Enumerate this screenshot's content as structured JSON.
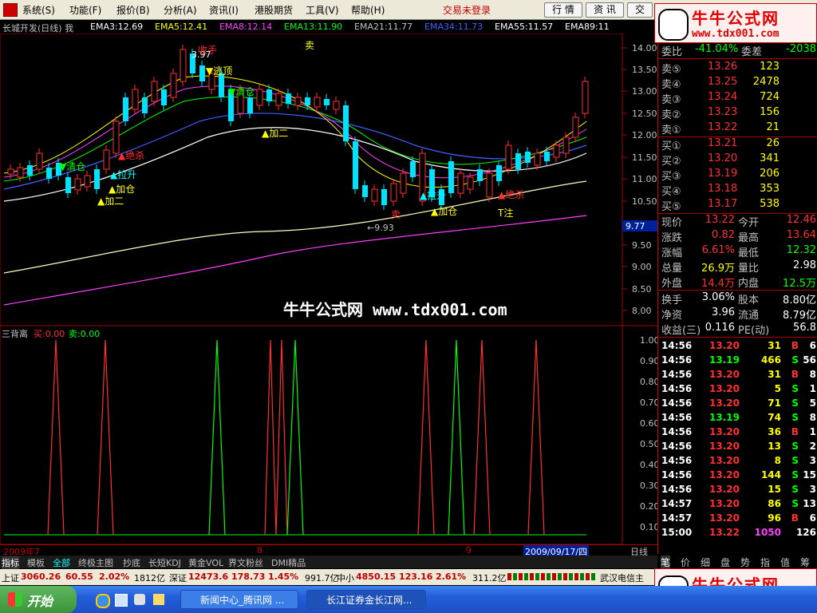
{
  "menu": {
    "items": [
      "系统(S)",
      "功能(F)",
      "报价(B)",
      "分析(A)",
      "资讯(I)",
      "港股期货",
      "工具(V)",
      "帮助(H)"
    ],
    "trade_login": "交易未登录",
    "buttons": [
      "行 情",
      "资 讯",
      "交"
    ]
  },
  "chart": {
    "title": "长城开发(日线) 我",
    "emas": [
      {
        "label": "EMA3:12.69",
        "color": "#ffffff"
      },
      {
        "label": "EMA5:12.41",
        "color": "#ffff00"
      },
      {
        "label": "EMA8:12.14",
        "color": "#ff40ff"
      },
      {
        "label": "EMA13:11.90",
        "color": "#00ff00"
      },
      {
        "label": "EMA21:11.77",
        "color": "#c0c0c0"
      },
      {
        "label": "EMA34:11.73",
        "color": "#4060ff"
      },
      {
        "label": "EMA55:11.57",
        "color": "#ffffff"
      },
      {
        "label": "EMA89:11",
        "color": "#ffffff"
      }
    ],
    "price_axis": [
      "14.00",
      "13.50",
      "13.00",
      "12.50",
      "12.00",
      "11.50",
      "11.00",
      "10.50",
      "10.00",
      "9.50",
      "9.00",
      "8.50",
      "8.00"
    ],
    "current_price_tag": "9.77",
    "annotations": {
      "high_mark": "3.97",
      "low_mark": "←9.93",
      "labels": [
        "收手",
        "卖",
        "▼清仓",
        "▼逃顶",
        "▼清仓",
        "▲加二",
        "▲加仓",
        "▲加二",
        "▲拉升",
        "▲绝杀",
        "▲绝杀",
        "▲拉升",
        "▲加仓",
        "卖",
        "T注",
        "▲加二",
        "收手",
        "▲加仓",
        "▲拉升",
        "▲加二"
      ]
    },
    "watermark": "牛牛公式网 www.tdx001.com",
    "indicator": {
      "name": "三背离",
      "buy_label": "买:0.00",
      "sell_label": "卖:0.00",
      "axis": [
        "1.00",
        "0.90",
        "0.80",
        "0.70",
        "0.60",
        "0.50",
        "0.40",
        "0.30",
        "0.20",
        "0.10"
      ]
    },
    "date_axis": {
      "left": "2009年7",
      "mid1": "8",
      "mid2": "9",
      "cursor": "2009/09/17/四",
      "period": "日线"
    }
  },
  "quote": {
    "ratio": {
      "label1": "委比",
      "val1": "-41.04%",
      "label2": "委差",
      "val2": "-2038"
    },
    "asks": [
      {
        "label": "卖⑤",
        "price": "13.26",
        "vol": "123"
      },
      {
        "label": "卖④",
        "price": "13.25",
        "vol": "2478"
      },
      {
        "label": "卖③",
        "price": "13.24",
        "vol": "724"
      },
      {
        "label": "卖②",
        "price": "13.23",
        "vol": "156"
      },
      {
        "label": "卖①",
        "price": "13.22",
        "vol": "21"
      }
    ],
    "bids": [
      {
        "label": "买①",
        "price": "13.21",
        "vol": "26"
      },
      {
        "label": "买②",
        "price": "13.20",
        "vol": "341"
      },
      {
        "label": "买③",
        "price": "13.19",
        "vol": "206"
      },
      {
        "label": "买④",
        "price": "13.18",
        "vol": "353"
      },
      {
        "label": "买⑤",
        "price": "13.17",
        "vol": "538"
      }
    ],
    "stats": [
      {
        "l1": "现价",
        "v1": "13.22",
        "c1": "red",
        "l2": "今开",
        "v2": "12.46",
        "c2": "red"
      },
      {
        "l1": "涨跌",
        "v1": "0.82",
        "c1": "red",
        "l2": "最高",
        "v2": "13.64",
        "c2": "red"
      },
      {
        "l1": "涨幅",
        "v1": "6.61%",
        "c1": "red",
        "l2": "最低",
        "v2": "12.32",
        "c2": "green"
      },
      {
        "l1": "总量",
        "v1": "26.9万",
        "c1": "yellow",
        "l2": "量比",
        "v2": "2.98",
        "c2": "white"
      },
      {
        "l1": "外盘",
        "v1": "14.4万",
        "c1": "red",
        "l2": "内盘",
        "v2": "12.5万",
        "c2": "green"
      }
    ],
    "stats2": [
      {
        "l1": "换手",
        "v1": "3.06%",
        "l2": "股本",
        "v2": "8.80亿"
      },
      {
        "l1": "净资",
        "v1": "3.96",
        "l2": "流通",
        "v2": "8.79亿"
      },
      {
        "l1": "收益(三)",
        "v1": "0.116",
        "l2": "PE(动)",
        "v2": "56.8"
      }
    ],
    "ticks": [
      {
        "time": "14:56",
        "price": "13.20",
        "vol": "31",
        "side": "B",
        "n": "6"
      },
      {
        "time": "14:56",
        "price": "13.19",
        "vol": "466",
        "side": "S",
        "n": "56"
      },
      {
        "time": "14:56",
        "price": "13.20",
        "vol": "31",
        "side": "B",
        "n": "8"
      },
      {
        "time": "14:56",
        "price": "13.20",
        "vol": "5",
        "side": "S",
        "n": "1"
      },
      {
        "time": "14:56",
        "price": "13.20",
        "vol": "71",
        "side": "S",
        "n": "5"
      },
      {
        "time": "14:56",
        "price": "13.19",
        "vol": "74",
        "side": "S",
        "n": "8"
      },
      {
        "time": "14:56",
        "price": "13.20",
        "vol": "36",
        "side": "B",
        "n": "1"
      },
      {
        "time": "14:56",
        "price": "13.20",
        "vol": "13",
        "side": "S",
        "n": "2"
      },
      {
        "time": "14:56",
        "price": "13.20",
        "vol": "8",
        "side": "S",
        "n": "3"
      },
      {
        "time": "14:56",
        "price": "13.20",
        "vol": "144",
        "side": "S",
        "n": "15"
      },
      {
        "time": "14:56",
        "price": "13.20",
        "vol": "15",
        "side": "S",
        "n": "3"
      },
      {
        "time": "14:57",
        "price": "13.20",
        "vol": "86",
        "side": "S",
        "n": "13"
      },
      {
        "time": "14:57",
        "price": "13.20",
        "vol": "96",
        "side": "B",
        "n": "6"
      },
      {
        "time": "15:00",
        "price": "13.22",
        "vol": "1050",
        "side": "",
        "n": "126"
      }
    ],
    "bottom_tabs": [
      "笔",
      "价",
      "细",
      "盘",
      "势",
      "指",
      "值",
      "筹"
    ]
  },
  "tabs": [
    "指标",
    "模板",
    "全部",
    "终极主图",
    "抄底",
    "长短KDJ",
    "黄金VOL",
    "界文粉丝",
    "DMI精品"
  ],
  "indexbar": {
    "sh_label": "上证",
    "sh_val": "3060.26",
    "sh_chg": "60.55",
    "sh_pct": "2.02%",
    "sh_amt": "1812亿",
    "sz_label": "深证",
    "sz_val": "12473.6",
    "sz_chg": "178.73",
    "sz_pct": "1.45%",
    "sz_amt": "991.7亿",
    "zx_label": "中小",
    "zx_val": "4850.15",
    "zx_chg": "123.16",
    "zx_pct": "2.61%",
    "zx_amt": "311.2亿",
    "stock": "武汉电信主"
  },
  "taskbar": {
    "start": "开始",
    "tasks": [
      "新闻中心_腾讯网 ...",
      "长江证券金长江网..."
    ]
  },
  "ad": {
    "title": "牛牛公式网",
    "url": "www.tdx001.com"
  }
}
